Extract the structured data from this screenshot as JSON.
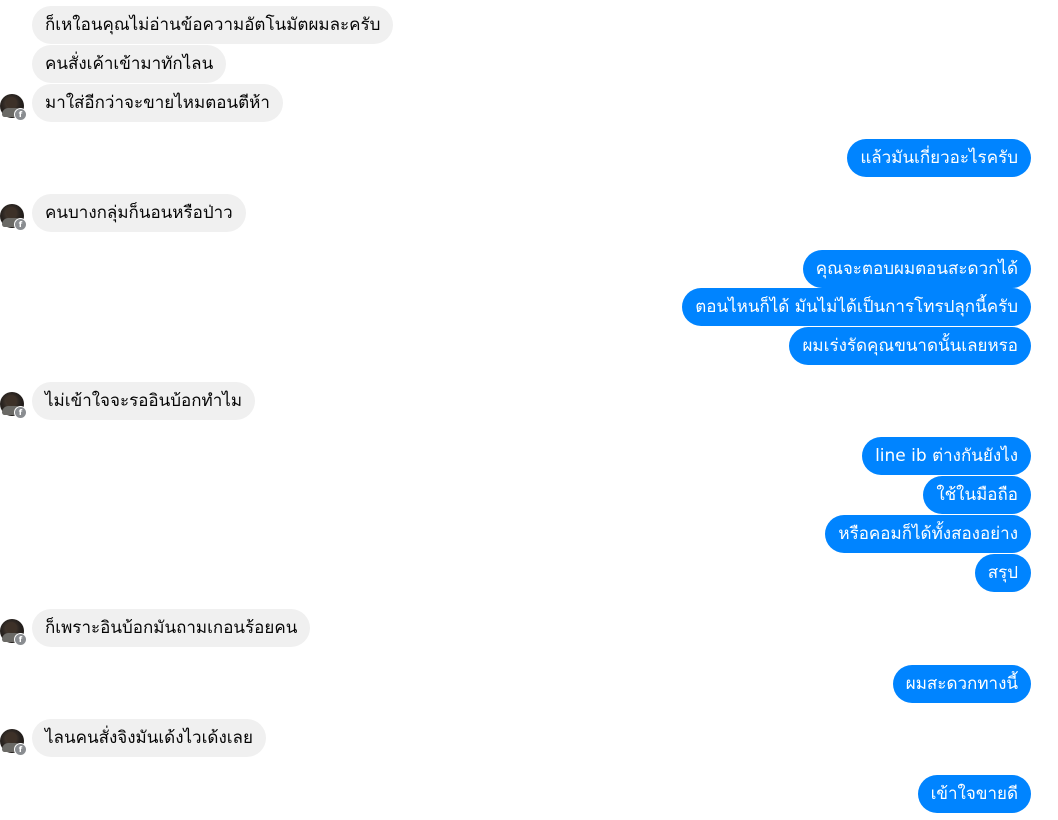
{
  "messages": [
    {
      "side": "in",
      "text": "ก็เหใอนคุณไม่อ่านข้อความอัตโนมัตผมละครับ"
    },
    {
      "side": "in",
      "text": "คนสั่งเค้าเข้ามาทักไลน"
    },
    {
      "side": "in",
      "text": "มาใส่อีกว่าจะขายไหมตอนตีห้า"
    },
    {
      "side": "out",
      "text": "แล้วมันเกี่ยวอะไรครับ"
    },
    {
      "side": "in",
      "text": "คนบางกลุ่มก็นอนหรือป่าว"
    },
    {
      "side": "out",
      "text": "คุณจะตอบผมตอนสะดวกได้"
    },
    {
      "side": "out",
      "text": "ตอนไหนก็ได้ มันไม่ได้เป็นการโทรปลุกนี้ครับ"
    },
    {
      "side": "out",
      "text": "ผมเร่งรัดคุณขนาดนั้นเลยหรอ"
    },
    {
      "side": "in",
      "text": "ไม่เข้าใจจะรออินบ้อกทำไม"
    },
    {
      "side": "out",
      "text": "line ib ต่างกันยังไง"
    },
    {
      "side": "out",
      "text": "ใช้ในมือถือ"
    },
    {
      "side": "out",
      "text": "หรือคอมก็ได้ทั้งสองอย่าง"
    },
    {
      "side": "out",
      "text": "สรุป"
    },
    {
      "side": "in",
      "text": "ก็เพราะอินบ้อกมันถามเกอนร้อยคน"
    },
    {
      "side": "out",
      "text": "ผมสะดวกทางนี้"
    },
    {
      "side": "in",
      "text": "ไลนคนสั่งจิงมันเด้งไวเด้งเลย"
    },
    {
      "side": "out",
      "text": "เข้าใจขายดี"
    }
  ],
  "icons": {
    "avatar": "contact-avatar-photo",
    "badge": "facebook-badge-icon"
  },
  "colors": {
    "incoming_bubble": "#f0f0f0",
    "outgoing_bubble": "#0084ff",
    "incoming_text": "#050505",
    "outgoing_text": "#ffffff"
  }
}
